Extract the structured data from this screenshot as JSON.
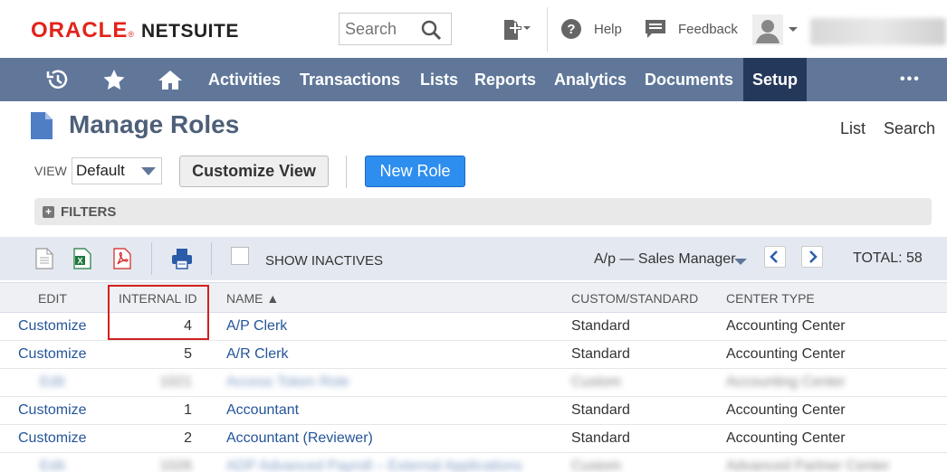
{
  "header": {
    "brand_oracle": "ORACLE",
    "brand_netsuite": "NETSUITE",
    "search_placeholder": "Search",
    "help_label": "Help",
    "feedback_label": "Feedback"
  },
  "nav": {
    "items": [
      {
        "label": "Activities"
      },
      {
        "label": "Transactions"
      },
      {
        "label": "Lists"
      },
      {
        "label": "Reports"
      },
      {
        "label": "Analytics"
      },
      {
        "label": "Documents"
      },
      {
        "label": "Setup",
        "active": true
      }
    ],
    "more_label": "•••"
  },
  "page": {
    "title": "Manage Roles",
    "list_link": "List",
    "search_link": "Search",
    "view_label": "VIEW",
    "view_value": "Default",
    "customize_view_label": "Customize View",
    "new_role_label": "New Role",
    "filters_label": "FILTERS"
  },
  "toolbar": {
    "show_inactives_label": "SHOW INACTIVES",
    "role_selector": "A/p — Sales Manager",
    "total_label": "TOTAL: 58"
  },
  "table": {
    "columns": [
      "EDIT",
      "INTERNAL ID",
      "NAME ▲",
      "CUSTOM/STANDARD",
      "CENTER TYPE"
    ],
    "rows": [
      {
        "edit": "Customize",
        "id": "4",
        "name": "A/P Clerk",
        "type": "Standard",
        "center": "Accounting Center",
        "blurred": false
      },
      {
        "edit": "Customize",
        "id": "5",
        "name": "A/R Clerk",
        "type": "Standard",
        "center": "Accounting Center",
        "blurred": false
      },
      {
        "edit": "Edit",
        "id": "1021",
        "name": "Access Token Role",
        "type": "Custom",
        "center": "Accounting Center",
        "blurred": true
      },
      {
        "edit": "Customize",
        "id": "1",
        "name": "Accountant",
        "type": "Standard",
        "center": "Accounting Center",
        "blurred": false
      },
      {
        "edit": "Customize",
        "id": "2",
        "name": "Accountant (Reviewer)",
        "type": "Standard",
        "center": "Accounting Center",
        "blurred": false
      },
      {
        "edit": "Edit",
        "id": "1026",
        "name": "ADP Advanced Payroll – External Applications",
        "type": "Custom",
        "center": "Advanced Partner Center",
        "blurred": true
      }
    ]
  },
  "colors": {
    "nav_bg": "#607799",
    "nav_active": "#24385b",
    "link": "#255599",
    "primary_button": "#2e8ef0",
    "highlight_box": "#d32020"
  }
}
